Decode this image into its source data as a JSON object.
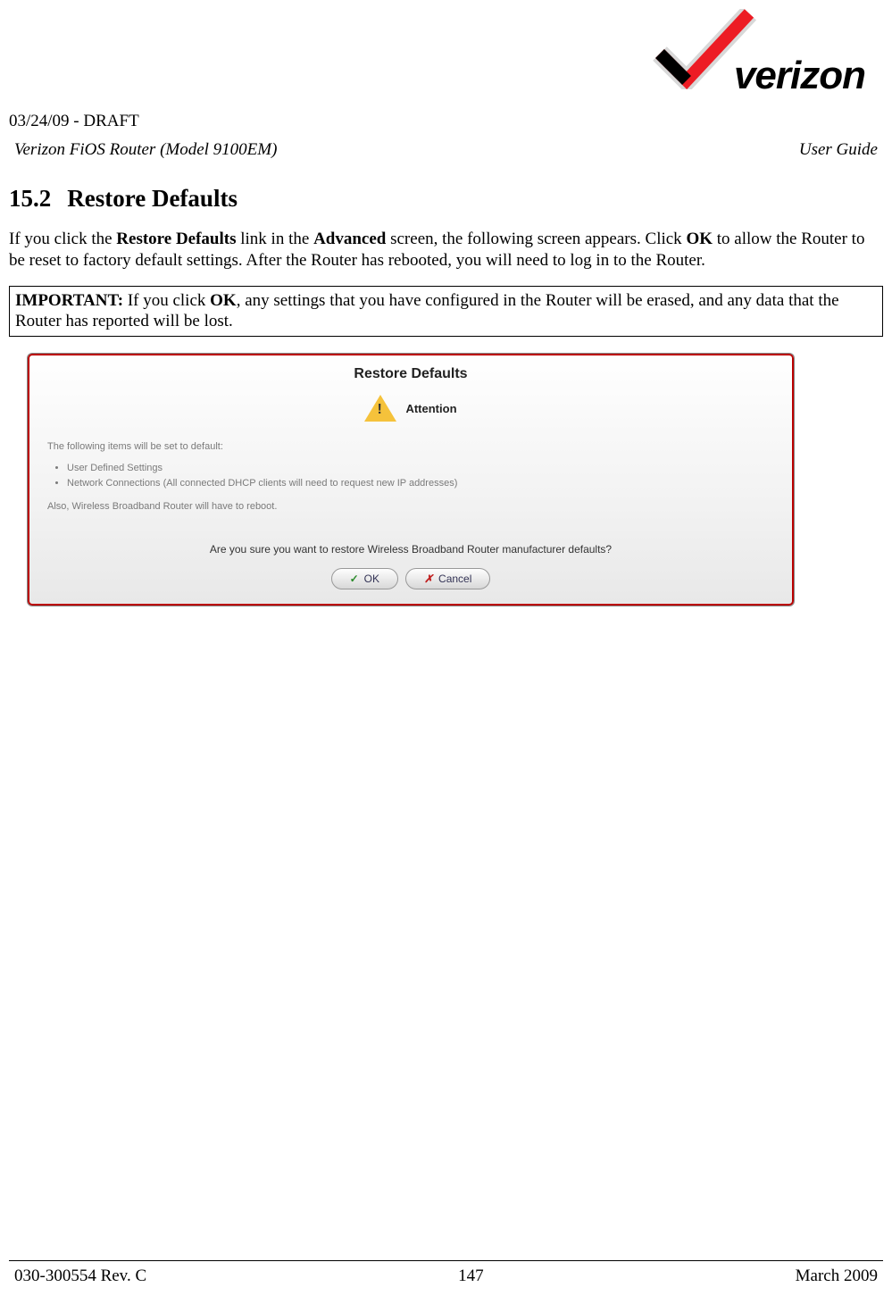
{
  "header": {
    "draft_line": "03/24/09 - DRAFT",
    "product": "Verizon FiOS Router (Model 9100EM)",
    "doc_type": "User Guide",
    "logo_text": "verizon"
  },
  "section": {
    "number": "15.2",
    "title": "Restore Defaults",
    "body_prefix": "If you click the ",
    "body_bold1": "Restore Defaults",
    "body_mid1": " link in the ",
    "body_bold2": "Advanced",
    "body_mid2": " screen, the following screen appears. Click ",
    "body_bold3": "OK",
    "body_suffix": " to allow the Router to be reset to factory default settings. After the Router has rebooted, you will need to log in to the Router."
  },
  "important": {
    "label": "IMPORTANT:",
    "text_prefix": " If you click ",
    "text_bold": "OK",
    "text_suffix": ", any settings that you have configured in the Router will be erased, and any data that the Router has reported will be lost."
  },
  "panel": {
    "title": "Restore Defaults",
    "attention": "Attention",
    "intro": "The following items will be set to default:",
    "items": [
      "User Defined Settings",
      "Network Connections (All connected DHCP clients will need to request new IP addresses)"
    ],
    "also": "Also, Wireless Broadband Router will have to reboot.",
    "confirm": "Are you sure you want to restore Wireless Broadband Router manufacturer defaults?",
    "ok_label": "OK",
    "cancel_label": "Cancel"
  },
  "footer": {
    "rev": "030-300554 Rev. C",
    "page": "147",
    "date": "March 2009"
  }
}
